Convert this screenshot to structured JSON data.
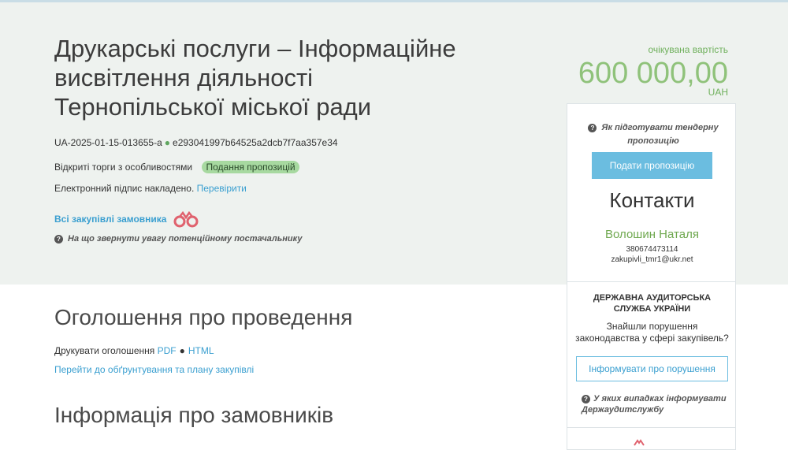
{
  "tender": {
    "title": "Друкарські послуги – Інформаційне висвітлення діяльності Тернопільської міської ради",
    "id": "UA-2025-01-15-013655-a",
    "hash": "e293041997b64525a2dcb7f7aa357e34",
    "procedure": "Відкриті торги з особливостями",
    "status": "Подання пропозицій",
    "signature_text": "Електронний підпис накладено.",
    "verify_link": "Перевірити",
    "all_purchases": "Всі закупівлі замовника",
    "attention_text": "На що звернути увагу потенційному постачальнику"
  },
  "value": {
    "label": "очікувана вартість",
    "amount": "600 000,00",
    "currency": "UAH"
  },
  "announcement": {
    "heading": "Оголошення про проведення",
    "print_label": "Друкувати оголошення",
    "pdf": "PDF",
    "html": "HTML",
    "plan_link": "Перейти до обґрунтування та плану закупівлі"
  },
  "customers": {
    "heading": "Інформація про замовників"
  },
  "sidebar": {
    "how_prepare": "Як підготувати тендерну пропозицію",
    "submit_button": "Подати пропозицію",
    "contacts_title": "Контакти",
    "contact_name": "Волошин Наталя",
    "contact_phone": "380674473114",
    "contact_email": "zakupivli_tmr1@ukr.net",
    "audit_title": "ДЕРЖАВНА АУДИТОРСЬКА СЛУЖБА УКРАЇНИ",
    "audit_text": "Знайшли порушення законодавства у сфері закупівель?",
    "report_button": "Інформувати про порушення",
    "cases_text": "У яких випадках інформувати Держаудитслужбу"
  },
  "icons": {
    "question": "question-circle-icon",
    "binoculars": "binoculars-icon"
  },
  "colors": {
    "accent": "#3a9fd0",
    "value_green": "#8fc27a",
    "status_badge": "#a7d9a0",
    "hero_bg": "#eef2ef"
  }
}
